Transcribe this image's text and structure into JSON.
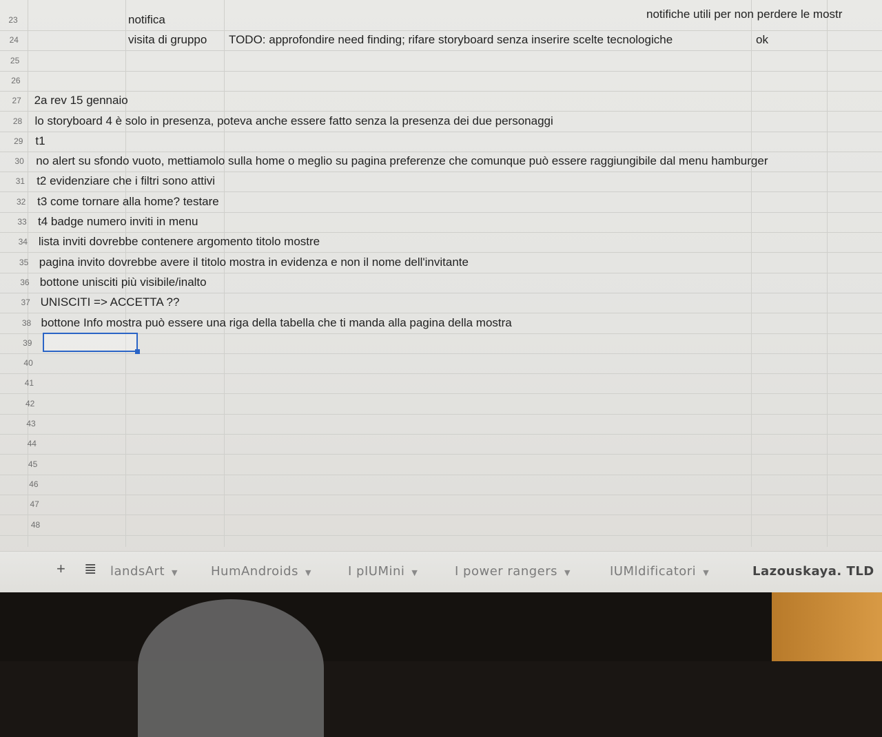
{
  "spreadsheet": {
    "rows": [
      {
        "num": "23",
        "cells": [
          {
            "col": "c",
            "text": "notifica"
          },
          {
            "col": "f",
            "text": "notifiche utili per non perdere le mostr"
          }
        ]
      },
      {
        "num": "24",
        "cells": [
          {
            "col": "c",
            "text": "visita di gruppo"
          },
          {
            "col": "d",
            "text": "TODO: approfondire need finding; rifare storyboard senza inserire scelte tecnologiche"
          },
          {
            "col": "e",
            "text": "ok"
          }
        ]
      },
      {
        "num": "25",
        "cells": []
      },
      {
        "num": "26",
        "cells": []
      },
      {
        "num": "27",
        "cells": [
          {
            "col": "b",
            "text": "2a rev 15 gennaio"
          }
        ]
      },
      {
        "num": "28",
        "cells": [
          {
            "col": "b",
            "text": "lo storyboard 4 è solo in presenza, poteva anche essere fatto senza la presenza dei due personaggi"
          }
        ]
      },
      {
        "num": "29",
        "cells": [
          {
            "col": "b",
            "text": "t1"
          }
        ]
      },
      {
        "num": "30",
        "cells": [
          {
            "col": "b",
            "text": "no alert su sfondo vuoto, mettiamolo sulla home o meglio su pagina preferenze che comunque può essere raggiungibile dal menu hamburger"
          }
        ]
      },
      {
        "num": "31",
        "cells": [
          {
            "col": "b",
            "text": "t2 evidenziare che i filtri sono attivi"
          }
        ]
      },
      {
        "num": "32",
        "cells": [
          {
            "col": "b",
            "text": "t3 come tornare alla home? testare"
          }
        ]
      },
      {
        "num": "33",
        "cells": [
          {
            "col": "b",
            "text": "t4 badge numero inviti in menu"
          }
        ]
      },
      {
        "num": "34",
        "cells": [
          {
            "col": "b",
            "text": "lista inviti dovrebbe contenere argomento titolo mostre"
          }
        ]
      },
      {
        "num": "35",
        "cells": [
          {
            "col": "b",
            "text": "pagina invito dovrebbe avere il titolo mostra in evidenza e non il nome dell'invitante"
          }
        ]
      },
      {
        "num": "36",
        "cells": [
          {
            "col": "b",
            "text": "bottone unisciti più visibile/inalto"
          }
        ]
      },
      {
        "num": "37",
        "cells": [
          {
            "col": "b",
            "text": "UNISCITI => ACCETTA ??"
          }
        ]
      },
      {
        "num": "38",
        "cells": [
          {
            "col": "b",
            "text": "bottone Info mostra può essere una riga della tabella che ti manda alla pagina della mostra"
          }
        ]
      },
      {
        "num": "39",
        "cells": []
      },
      {
        "num": "40",
        "cells": []
      },
      {
        "num": "41",
        "cells": []
      },
      {
        "num": "42",
        "cells": []
      },
      {
        "num": "43",
        "cells": []
      },
      {
        "num": "44",
        "cells": []
      },
      {
        "num": "45",
        "cells": []
      },
      {
        "num": "46",
        "cells": []
      },
      {
        "num": "47",
        "cells": []
      },
      {
        "num": "48",
        "cells": []
      }
    ],
    "selected_row": "39"
  },
  "tabbar": {
    "add_label": "+",
    "list_label": "≣",
    "tabs": [
      {
        "label": "landsArt"
      },
      {
        "label": "HumAndroids"
      },
      {
        "label": "I pIUMini"
      },
      {
        "label": "I power rangers"
      },
      {
        "label": "IUMldificatori"
      },
      {
        "label": "Lazouskaya. TLD"
      }
    ]
  }
}
